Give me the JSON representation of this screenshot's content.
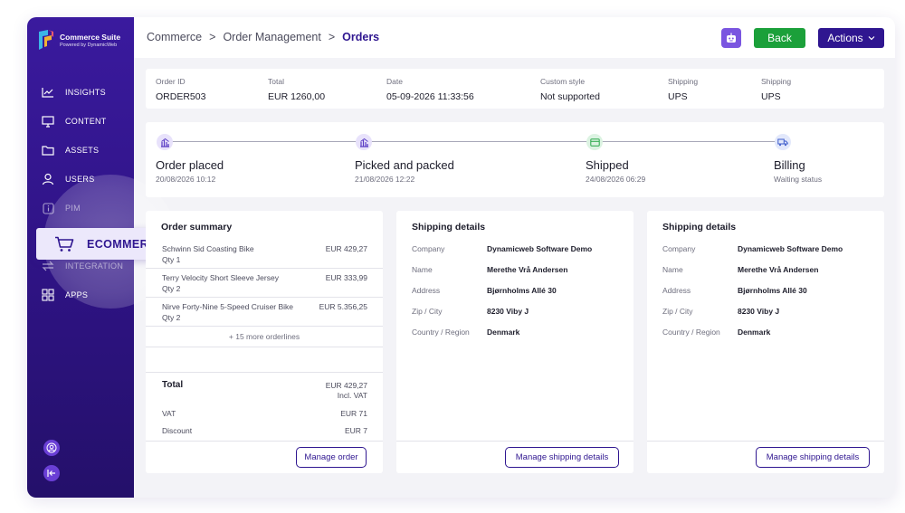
{
  "app": {
    "logo_title": "Commerce Suite",
    "logo_subtitle": "Powered by DynamicWeb"
  },
  "sidebar": {
    "items": [
      {
        "label": "INSIGHTS",
        "icon": "chart-line-icon"
      },
      {
        "label": "CONTENT",
        "icon": "monitor-icon"
      },
      {
        "label": "ASSETS",
        "icon": "folder-icon"
      },
      {
        "label": "USERS",
        "icon": "user-icon"
      },
      {
        "label": "PIM",
        "icon": "info-icon"
      },
      {
        "label": "ECOMMERCE",
        "icon": "cart-icon"
      },
      {
        "label": "INTEGRATION",
        "icon": "arrows-icon"
      },
      {
        "label": "APPS",
        "icon": "grid-icon"
      }
    ],
    "active": "ECOMMERCE"
  },
  "header": {
    "breadcrumb": [
      "Commerce",
      "Order Management",
      "Orders"
    ],
    "back_label": "Back",
    "actions_label": "Actions"
  },
  "order_info": [
    {
      "label": "Order ID",
      "value": "ORDER503"
    },
    {
      "label": "Total",
      "value": "EUR 1260,00"
    },
    {
      "label": "Date",
      "value": "05-09-2026 11:33:56"
    },
    {
      "label": "Custom style",
      "value": "Not supported"
    },
    {
      "label": "Shipping",
      "value": "UPS"
    },
    {
      "label": "Shipping",
      "value": "UPS"
    }
  ],
  "progress": [
    {
      "title": "Order placed",
      "sub": "20/08/2026 10:12",
      "icon": "building-icon"
    },
    {
      "title": "Picked and packed",
      "sub": "21/08/2026 12:22",
      "icon": "building-icon"
    },
    {
      "title": "Shipped",
      "sub": "24/08/2026 06:29",
      "icon": "card-icon"
    },
    {
      "title": "Billing",
      "sub": "Waiting status",
      "icon": "truck-icon"
    }
  ],
  "order_summary": {
    "title": "Order summary",
    "lines": [
      {
        "name": "Schwinn Sid Coasting Bike",
        "qty": "Qty 1",
        "price": "EUR 429,27"
      },
      {
        "name": "Terry Velocity Short Sleeve Jersey",
        "qty": "Qty 2",
        "price": "EUR 333,99"
      },
      {
        "name": "Nirve Forty-Nine 5-Speed Cruiser Bike",
        "qty": "Qty 2",
        "price": "EUR 5.356,25"
      }
    ],
    "more": "+ 15 more orderlines",
    "total_label": "Total",
    "total_value": "EUR 429,27",
    "total_note": "Incl. VAT",
    "vat_label": "VAT",
    "vat_value": "EUR 71",
    "discount_label": "Discount",
    "discount_value": "EUR 7",
    "button": "Manage order"
  },
  "shipping_cards": [
    {
      "title": "Shipping details",
      "rows": [
        {
          "label": "Company",
          "value": "Dynamicweb Software Demo"
        },
        {
          "label": "Name",
          "value": "Merethe Vrå Andersen"
        },
        {
          "label": "Address",
          "value": "Bjørnholms Allé 30"
        },
        {
          "label": "Zip / City",
          "value": "8230 Viby J"
        },
        {
          "label": "Country / Region",
          "value": "Denmark"
        }
      ],
      "button": "Manage shipping details"
    },
    {
      "title": "Shipping details",
      "rows": [
        {
          "label": "Company",
          "value": "Dynamicweb Software Demo"
        },
        {
          "label": "Name",
          "value": "Merethe Vrå Andersen"
        },
        {
          "label": "Address",
          "value": "Bjørnholms Allé 30"
        },
        {
          "label": "Zip / City",
          "value": "8230 Viby J"
        },
        {
          "label": "Country / Region",
          "value": "Denmark"
        }
      ],
      "button": "Manage shipping details"
    }
  ],
  "colors": {
    "primary": "#2f1690",
    "success": "#1ba03a",
    "accent": "#7a55e0",
    "sidebar_top": "#3a1a9e",
    "sidebar_bottom": "#24106a"
  }
}
